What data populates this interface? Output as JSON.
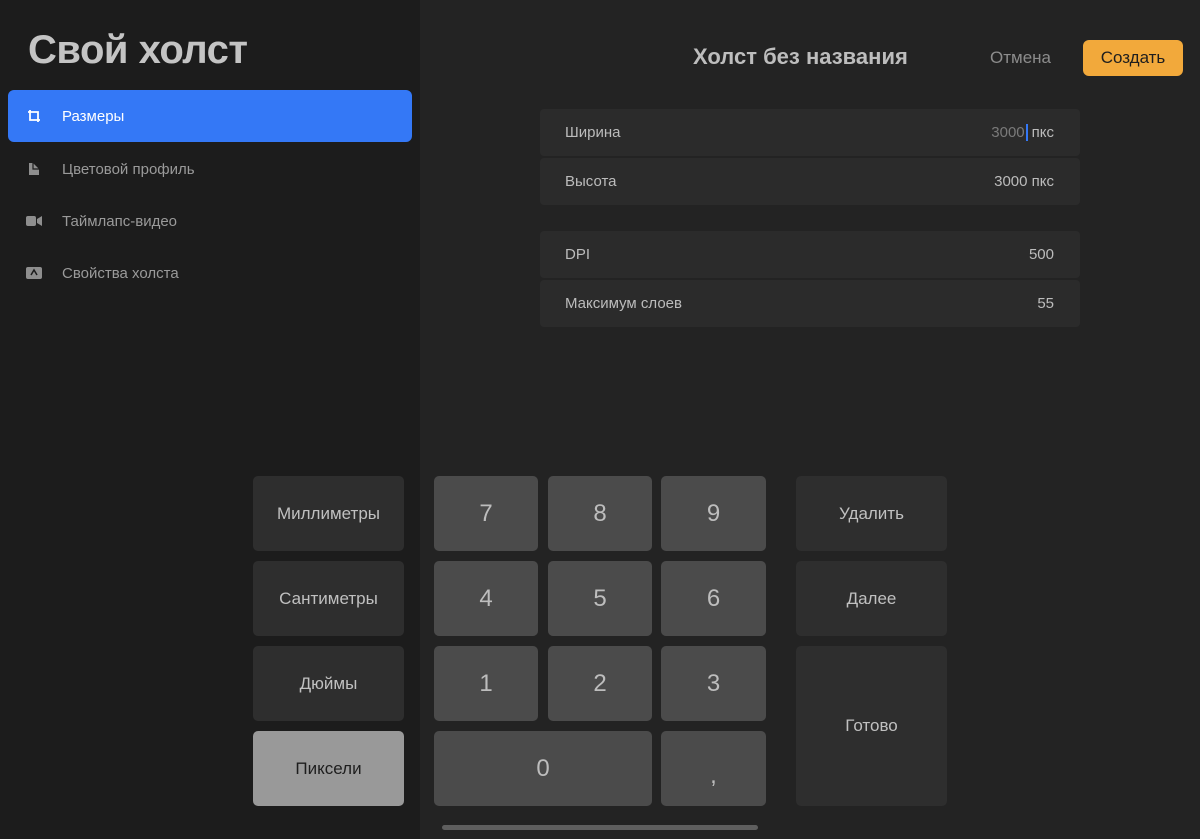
{
  "sidebar": {
    "title": "Свой холст",
    "items": [
      {
        "label": "Размеры",
        "icon": "crop-icon",
        "active": true
      },
      {
        "label": "Цветовой профиль",
        "icon": "color-profile-icon",
        "active": false
      },
      {
        "label": "Таймлапс-видео",
        "icon": "video-camera-icon",
        "active": false
      },
      {
        "label": "Свойства холста",
        "icon": "canvas-properties-icon",
        "active": false
      }
    ]
  },
  "header": {
    "title": "Холст без названия",
    "cancel_label": "Отмена",
    "create_label": "Создать"
  },
  "fields": {
    "width": {
      "label": "Ширина",
      "value": "3000",
      "unit": "пкс"
    },
    "height": {
      "label": "Высота",
      "value": "3000 пкс"
    },
    "dpi": {
      "label": "DPI",
      "value": "500"
    },
    "max_layers": {
      "label": "Максимум слоев",
      "value": "55"
    }
  },
  "keypad": {
    "units": [
      "Миллиметры",
      "Сантиметры",
      "Дюймы",
      "Пиксели"
    ],
    "selected_unit": "Пиксели",
    "digits": [
      "7",
      "8",
      "9",
      "4",
      "5",
      "6",
      "1",
      "2",
      "3",
      "0",
      ","
    ],
    "delete_label": "Удалить",
    "next_label": "Далее",
    "done_label": "Готово"
  },
  "colors": {
    "accent": "#3478f6",
    "create_button": "#f2a93b",
    "background": "#232323",
    "sidebar_background": "#1c1c1c"
  }
}
